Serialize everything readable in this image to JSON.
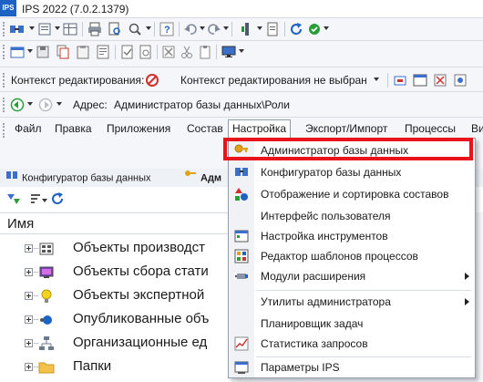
{
  "window": {
    "logo_text": "IPS",
    "title": "IPS 2022 (7.0.2.1379)"
  },
  "context_bar": {
    "label": "Контекст редактирования:",
    "value": "Контекст редактирования не выбран"
  },
  "address_bar": {
    "label": "Адрес:",
    "value": "Администратор базы данных\\Роли"
  },
  "menubar": {
    "items": [
      {
        "label": "Файл",
        "name": "menu-file"
      },
      {
        "label": "Правка",
        "name": "menu-edit"
      },
      {
        "label": "Приложения",
        "name": "menu-apps"
      },
      {
        "label": "Состав",
        "name": "menu-composition"
      },
      {
        "label": "Настройка",
        "name": "menu-settings"
      },
      {
        "label": "Экспорт/Импорт",
        "name": "menu-export-import"
      },
      {
        "label": "Процессы",
        "name": "menu-processes"
      },
      {
        "label": "Ви",
        "name": "menu-view"
      }
    ]
  },
  "tabs": {
    "tab1": "Конфигуратор базы данных",
    "tab2": "Адм"
  },
  "tree": {
    "header": "Имя",
    "items": [
      {
        "label": "Объекты производст",
        "icon": "production-objects-icon"
      },
      {
        "label": "Объекты сбора стати",
        "icon": "statistics-objects-icon"
      },
      {
        "label": "Объекты экспертной",
        "icon": "lightbulb-icon"
      },
      {
        "label": "Опубликованные объ",
        "icon": "published-objects-icon"
      },
      {
        "label": "Организационные ед",
        "icon": "org-structure-icon"
      },
      {
        "label": "Папки",
        "icon": "folder-icon"
      }
    ]
  },
  "dropdown": {
    "items": [
      {
        "label": "Администратор базы данных",
        "icon": "key-icon",
        "submenu": false
      },
      {
        "label": "Конфигуратор базы данных",
        "icon": "configurator-icon",
        "submenu": false
      },
      {
        "label": "Отображение и сортировка составов",
        "icon": "shapes-icon",
        "submenu": false
      },
      {
        "label": "Интерфейс пользователя",
        "icon": "",
        "submenu": false
      },
      {
        "label": "Настройка инструментов",
        "icon": "tools-window-icon",
        "submenu": false
      },
      {
        "label": "Редактор шаблонов процессов",
        "icon": "process-template-icon",
        "submenu": false
      },
      {
        "label": "Модули расширения",
        "icon": "plugin-icon",
        "submenu": true
      },
      {
        "label": "Утилиты администратора",
        "icon": "",
        "submenu": true
      },
      {
        "label": "Планировщик задач",
        "icon": "",
        "submenu": false
      },
      {
        "label": "Статистика запросов",
        "icon": "chart-icon",
        "submenu": false
      },
      {
        "label": "Параметры IPS",
        "icon": "parameters-icon",
        "submenu": false
      }
    ]
  },
  "colors": {
    "highlight": "#e8131b",
    "accent": "#1e62c4",
    "menu_border": "#8e9db3"
  }
}
